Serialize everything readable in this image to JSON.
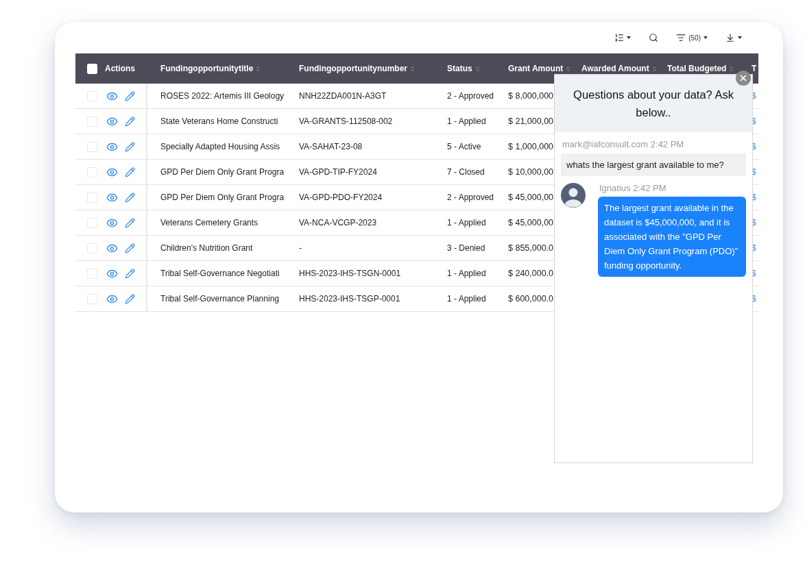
{
  "toolbar": {
    "filter_count": "(50)"
  },
  "table": {
    "select_all": {
      "checked": false
    },
    "columns": [
      {
        "label": "Actions",
        "kind": "plain"
      },
      {
        "label": "Fundingopportunitytitle",
        "kind": "sortable"
      },
      {
        "label": "Fundingopportunitynumber",
        "kind": "sortable"
      },
      {
        "label": "Status",
        "kind": "sortable"
      },
      {
        "label": "Grant Amount",
        "kind": "sortable"
      },
      {
        "label": "Awarded Amount",
        "kind": "sortable"
      },
      {
        "label": "Total Budgeted",
        "kind": "sortable"
      },
      {
        "label": "T",
        "kind": "plain"
      }
    ],
    "rows": [
      {
        "checked": false,
        "title": "ROSES 2022: Artemis III Geology",
        "number": "NNH22ZDA001N-A3GT",
        "status": "2 - Approved",
        "grant_amount": "$ 8,000,000",
        "column_8": "$"
      },
      {
        "checked": false,
        "title": "State Veterans Home Constructi",
        "number": "VA-GRANTS-112508-002",
        "status": "1 - Applied",
        "grant_amount": "$ 21,000,00",
        "column_8": "$"
      },
      {
        "checked": false,
        "title": "Specially Adapted Housing Assis",
        "number": "VA-SAHAT-23-08",
        "status": "5 - Active",
        "grant_amount": "$ 1,000,000",
        "column_8": "$"
      },
      {
        "checked": false,
        "title": "GPD Per Diem Only Grant Progra",
        "number": "VA-GPD-TIP-FY2024",
        "status": "7 - Closed",
        "grant_amount": "$ 10,000,00",
        "column_8": "$"
      },
      {
        "checked": false,
        "title": "GPD Per Diem Only Grant Progra",
        "number": "VA-GPD-PDO-FY2024",
        "status": "2 - Approved",
        "grant_amount": "$ 45,000,00",
        "column_8": "$"
      },
      {
        "checked": false,
        "title": "Veterans Cemetery Grants",
        "number": "VA-NCA-VCGP-2023",
        "status": "1 - Applied",
        "grant_amount": "$ 45,000,00",
        "column_8": "$"
      },
      {
        "checked": false,
        "title": "Children's Nutrition Grant",
        "number": "-",
        "status": "3 - Denied",
        "grant_amount": "$ 855,000.0",
        "column_8": "$"
      },
      {
        "checked": false,
        "title": "Tribal Self-Governance Negotiati",
        "number": "HHS-2023-IHS-TSGN-0001",
        "status": "1 - Applied",
        "grant_amount": "$ 240,000.0",
        "column_8": "$"
      },
      {
        "checked": false,
        "title": "Tribal Self-Governance Planning",
        "number": "HHS-2023-IHS-TSGP-0001",
        "status": "1 - Applied",
        "grant_amount": "$ 600,000.0",
        "column_8": "$"
      }
    ]
  },
  "chat": {
    "title": "Questions about your data? Ask below..",
    "messages": [
      {
        "kind": "user",
        "sender": "mark@iafconsult.com 2:42 PM",
        "text": "whats the largest grant available to me?"
      },
      {
        "kind": "bot",
        "sender": "Ignatius 2:42 PM",
        "text": "The largest grant available in the dataset is $45,000,000, and it is associated with the \"GPD Per Diem Only Grant Program (PDO)\" funding opportunity."
      }
    ]
  }
}
